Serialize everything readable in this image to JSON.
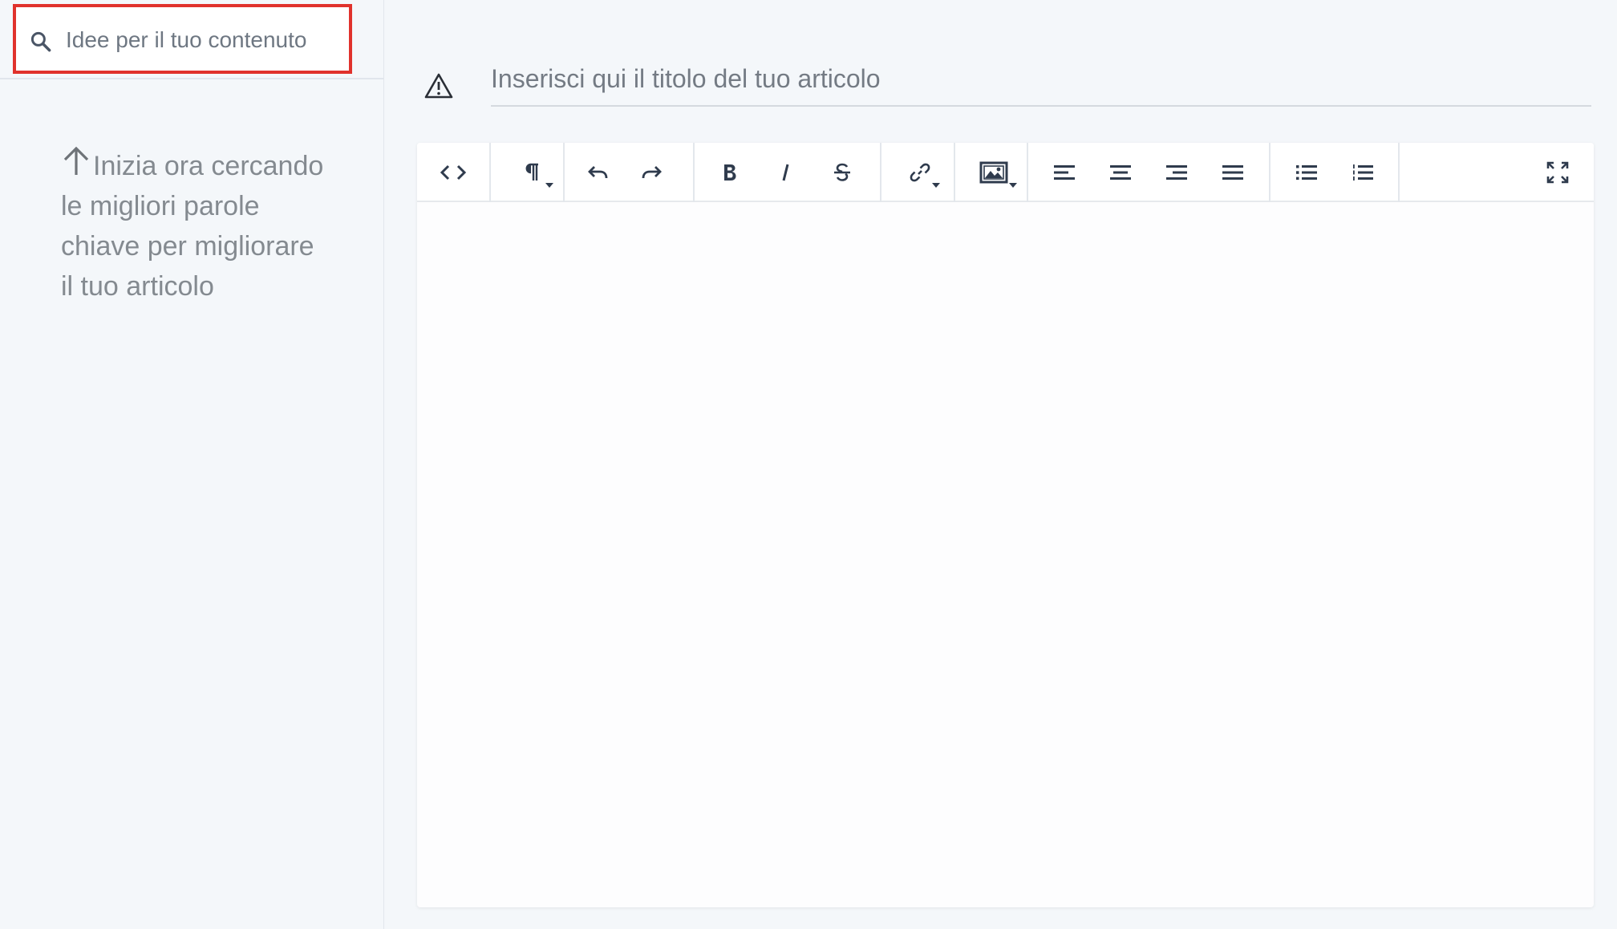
{
  "search": {
    "placeholder": "Idee per il tuo contenuto",
    "icon": "search-icon",
    "highlight_color": "#e0322c"
  },
  "sidebar": {
    "hint_icon": "arrow-up-icon",
    "hint_text": "Inizia ora cercando le migliori parole chiave per migliorare il tuo articolo"
  },
  "article": {
    "warning_icon": "warning-icon",
    "title_placeholder": "Inserisci qui il titolo del tuo articolo",
    "title_value": ""
  },
  "toolbar": {
    "icon_color": "#2f3b4d",
    "groups": [
      [
        "code-view-icon"
      ],
      [
        "paragraph-format-icon"
      ],
      [
        "undo-icon",
        "redo-icon"
      ],
      [
        "bold-icon",
        "italic-icon",
        "strikethrough-icon"
      ],
      [
        "insert-link-icon"
      ],
      [
        "insert-image-icon"
      ],
      [
        "align-left-icon",
        "align-center-icon",
        "align-right-icon",
        "align-justify-icon"
      ],
      [
        "unordered-list-icon",
        "ordered-list-icon"
      ],
      [
        "fullscreen-icon"
      ]
    ]
  },
  "colors": {
    "background": "#f4f7fa",
    "editor_background": "#fdfdfe",
    "text": "#3d4a5c",
    "muted_text": "#848a90"
  }
}
